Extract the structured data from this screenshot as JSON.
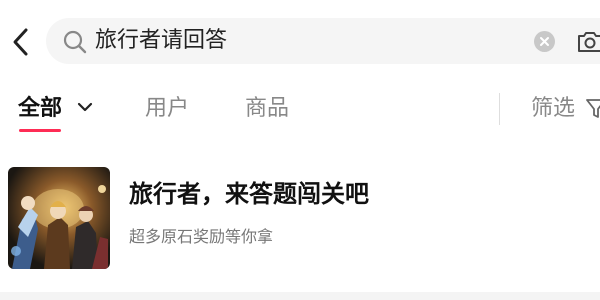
{
  "search": {
    "query": "旅行者请回答",
    "icons": {
      "back": "back-chevron-icon",
      "search": "search-icon",
      "clear": "clear-icon",
      "camera": "camera-icon"
    }
  },
  "tabs": {
    "items": [
      {
        "label": "全部",
        "active": true
      },
      {
        "label": "用户",
        "active": false
      },
      {
        "label": "商品",
        "active": false
      }
    ],
    "filter_label": "筛选",
    "accent_color": "#fe2c55"
  },
  "results": [
    {
      "title": "旅行者，来答题闯关吧",
      "subtitle": "超多原石奖励等你拿",
      "thumbnail_icon": "game-artwork-thumbnail"
    }
  ]
}
